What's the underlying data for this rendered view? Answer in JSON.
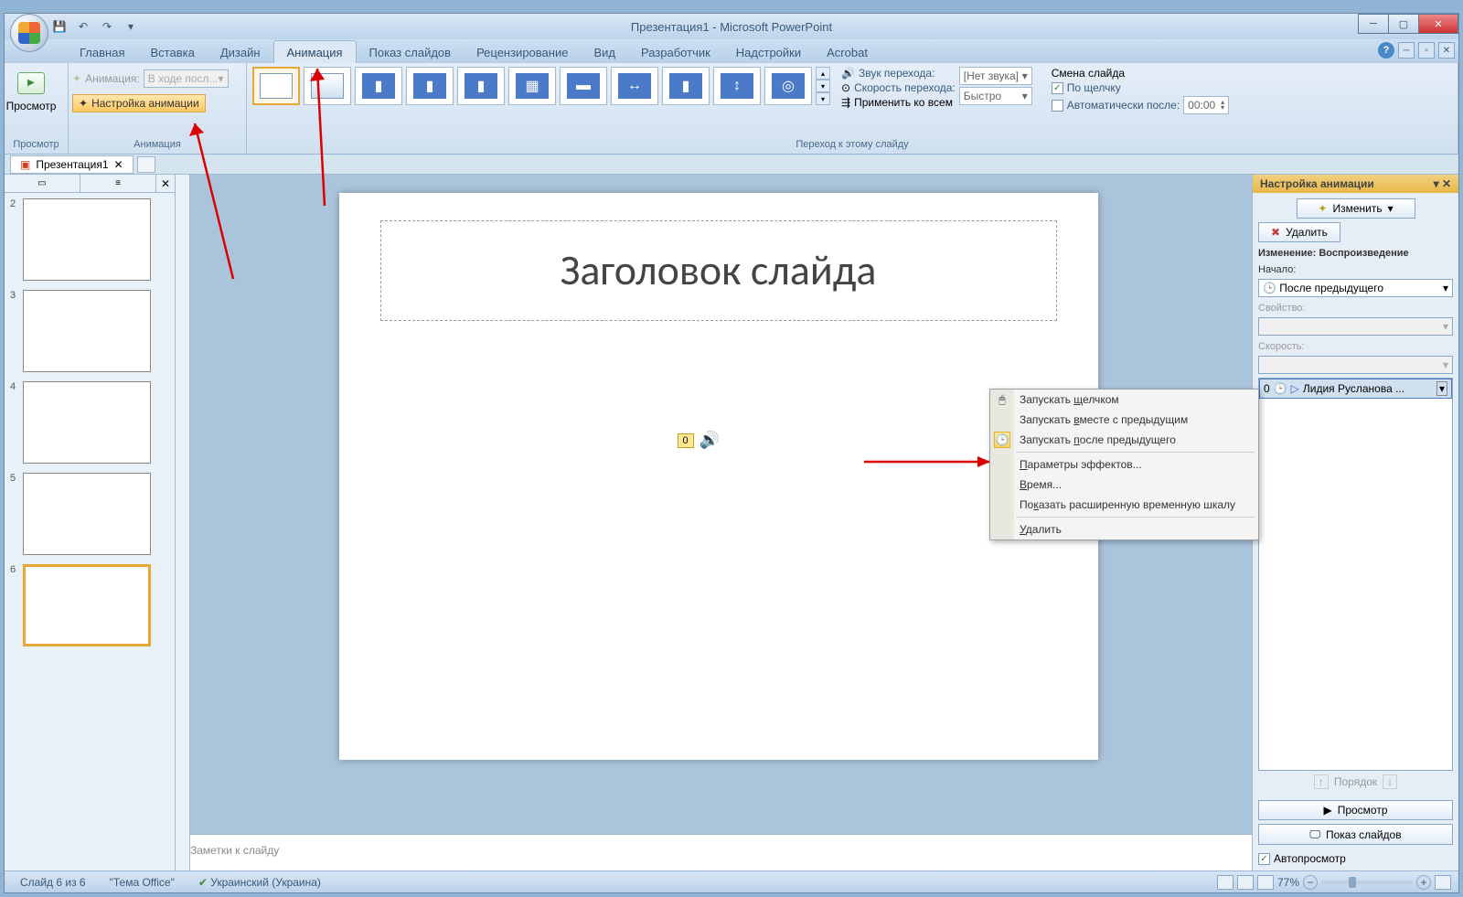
{
  "window": {
    "title": "Презентация1 - Microsoft PowerPoint"
  },
  "tabs": {
    "home": "Главная",
    "insert": "Вставка",
    "design": "Дизайн",
    "animations": "Анимация",
    "slideshow": "Показ слайдов",
    "review": "Рецензирование",
    "view": "Вид",
    "developer": "Разработчик",
    "addins": "Надстройки",
    "acrobat": "Acrobat"
  },
  "ribbon": {
    "preview": "Просмотр",
    "preview_group": "Просмотр",
    "animate_label": "Анимация:",
    "animate_value": "В ходе посл...",
    "custom_anim": "Настройка анимации",
    "anim_group": "Анимация",
    "sound_label": "Звук перехода:",
    "sound_value": "[Нет звука]",
    "speed_label": "Скорость перехода:",
    "speed_value": "Быстро",
    "apply_all": "Применить ко всем",
    "trans_group": "Переход к этому слайду",
    "advance_title": "Смена слайда",
    "on_click": "По щелчку",
    "auto_after": "Автоматически после:",
    "auto_value": "00:00"
  },
  "doc_tab": "Презентация1",
  "slides": [
    {
      "num": "2"
    },
    {
      "num": "3"
    },
    {
      "num": "4"
    },
    {
      "num": "5"
    },
    {
      "num": "6",
      "selected": true
    }
  ],
  "slide": {
    "title": "Заголовок слайда",
    "sound_tag": "0"
  },
  "notes_placeholder": "Заметки к слайду",
  "task_pane": {
    "title": "Настройка анимации",
    "change_btn": "Изменить",
    "remove_btn": "Удалить",
    "modify_label": "Изменение: Воспроизведение",
    "start_label": "Начало:",
    "start_value": "После предыдущего",
    "property_label": "Свойство:",
    "speed_label": "Скорость:",
    "item_num": "0",
    "item_label": "Лидия Русланова ...",
    "order_label": "Порядок",
    "play_btn": "Просмотр",
    "show_btn": "Показ слайдов",
    "autopreview": "Автопросмотр"
  },
  "context_menu": {
    "on_click": "Запускать щелчком",
    "with_prev": "Запускать вместе с предыдущим",
    "after_prev": "Запускать после предыдущего",
    "effect_opts": "Параметры эффектов...",
    "timing": "Время...",
    "show_timeline": "Показать расширенную временную шкалу",
    "remove": "Удалить"
  },
  "statusbar": {
    "slide_info": "Слайд 6 из 6",
    "theme": "\"Тема Office\"",
    "lang": "Украинский (Украина)",
    "zoom": "77%"
  }
}
